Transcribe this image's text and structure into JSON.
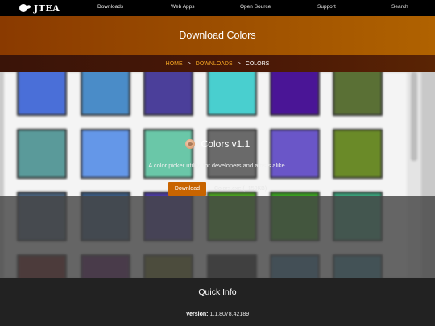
{
  "nav": {
    "logo_text": "JTEA",
    "links": [
      "Downloads",
      "Web Apps",
      "Open Source",
      "Support",
      "Search"
    ]
  },
  "header": {
    "title": "Download Colors"
  },
  "breadcrumb": {
    "home": "HOME",
    "downloads": "DOWNLOADS",
    "current": "COLORS",
    "separator": ">"
  },
  "preview": {
    "swatch_colors": [
      [
        "#4a6fd8",
        "#4a8cc8",
        "#4b3f9a",
        "#49cfcf",
        "#4a1596",
        "#5a7035"
      ],
      [
        "#5a9a9a",
        "#6497e8",
        "#6ac7a8",
        "#6a6a6a",
        "#6a56c8",
        "#6a8a28"
      ],
      [
        "#48607a",
        "#3a5a80",
        "#4a3aa0",
        "#4aa020",
        "#3aa020",
        "#3aa07a"
      ],
      [
        "#6a1010",
        "#5a1060",
        "#6a6a1a",
        "#2a2a2a",
        "#3a7aa0",
        "#3a8aa0"
      ]
    ]
  },
  "app": {
    "name": "Colors v1.1",
    "icon": "colors-app-icon",
    "tagline": "A color picker utility, for developers and artists alike.",
    "download_label": "Download",
    "file_label": "Colors.exe (~150KB)"
  },
  "quick_info": {
    "title": "Quick Info",
    "version_label": "Version:",
    "version_value": "1.1.8078.42189"
  },
  "colors": {
    "accent": "#c86400",
    "crumb_link": "#f5a623",
    "nav_bg": "#000000",
    "footer_bg": "#222222"
  }
}
